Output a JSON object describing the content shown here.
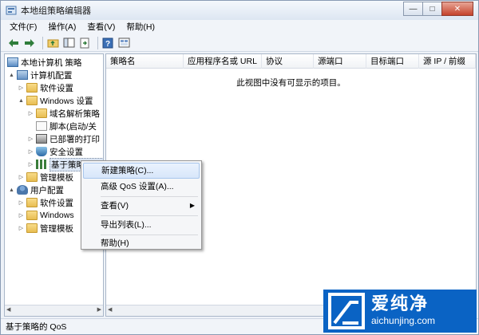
{
  "window": {
    "title": "本地组策略编辑器",
    "controls": {
      "minimize": "—",
      "maximize": "□",
      "close": "✕"
    }
  },
  "menubar": {
    "items": [
      "文件(F)",
      "操作(A)",
      "查看(V)",
      "帮助(H)"
    ]
  },
  "toolbar": {
    "buttons": [
      "back-icon",
      "forward-icon",
      "up-folder-icon",
      "show-hide-tree-icon",
      "export-list-icon",
      "help-icon",
      "properties-icon"
    ]
  },
  "tree": {
    "nodes": [
      {
        "label": "本地计算机 策略",
        "icon": "policy-icon",
        "expander": ""
      },
      {
        "label": "计算机配置",
        "icon": "computer-icon",
        "expander": "▲"
      },
      {
        "label": "软件设置",
        "icon": "folder-icon",
        "expander": "▷"
      },
      {
        "label": "Windows 设置",
        "icon": "folder-icon",
        "expander": "▲"
      },
      {
        "label": "域名解析策略",
        "icon": "folder-icon",
        "expander": "▷"
      },
      {
        "label": "脚本(启动/关",
        "icon": "doc-icon",
        "expander": ""
      },
      {
        "label": "已部署的打印",
        "icon": "printer-icon",
        "expander": "▷"
      },
      {
        "label": "安全设置",
        "icon": "shield-icon",
        "expander": "▷"
      },
      {
        "label": "基于策略的 Q",
        "icon": "chart-icon",
        "expander": "▷"
      },
      {
        "label": "管理模板",
        "icon": "folder-icon",
        "expander": "▷"
      },
      {
        "label": "用户配置",
        "icon": "user-icon",
        "expander": "▲"
      },
      {
        "label": "软件设置",
        "icon": "folder-icon",
        "expander": "▷"
      },
      {
        "label": "Windows",
        "icon": "folder-icon",
        "expander": "▷"
      },
      {
        "label": "管理模板",
        "icon": "folder-icon",
        "expander": "▷"
      }
    ]
  },
  "list": {
    "columns": [
      "策略名",
      "应用程序名或 URL",
      "协议",
      "源端口",
      "目标端口",
      "源 IP / 前缀"
    ],
    "empty_message": "此视图中没有可显示的项目。"
  },
  "context_menu": {
    "items": [
      {
        "label": "新建策略(C)...",
        "submenu": false,
        "highlighted": true
      },
      {
        "label": "高级 QoS 设置(A)...",
        "submenu": false,
        "highlighted": false
      },
      {
        "label": "查看(V)",
        "submenu": true,
        "highlighted": false
      },
      {
        "label": "导出列表(L)...",
        "submenu": false,
        "highlighted": false
      },
      {
        "label": "帮助(H)",
        "submenu": false,
        "highlighted": false
      }
    ],
    "submenu_arrow": "▶"
  },
  "statusbar": {
    "text": "基于策略的 QoS"
  },
  "watermark": {
    "brand": "爱纯净",
    "url": "aichunjing.com",
    "color": "#0a63c4"
  },
  "colors": {
    "accent": "#0a63c4",
    "selection": "#dde7f5"
  }
}
